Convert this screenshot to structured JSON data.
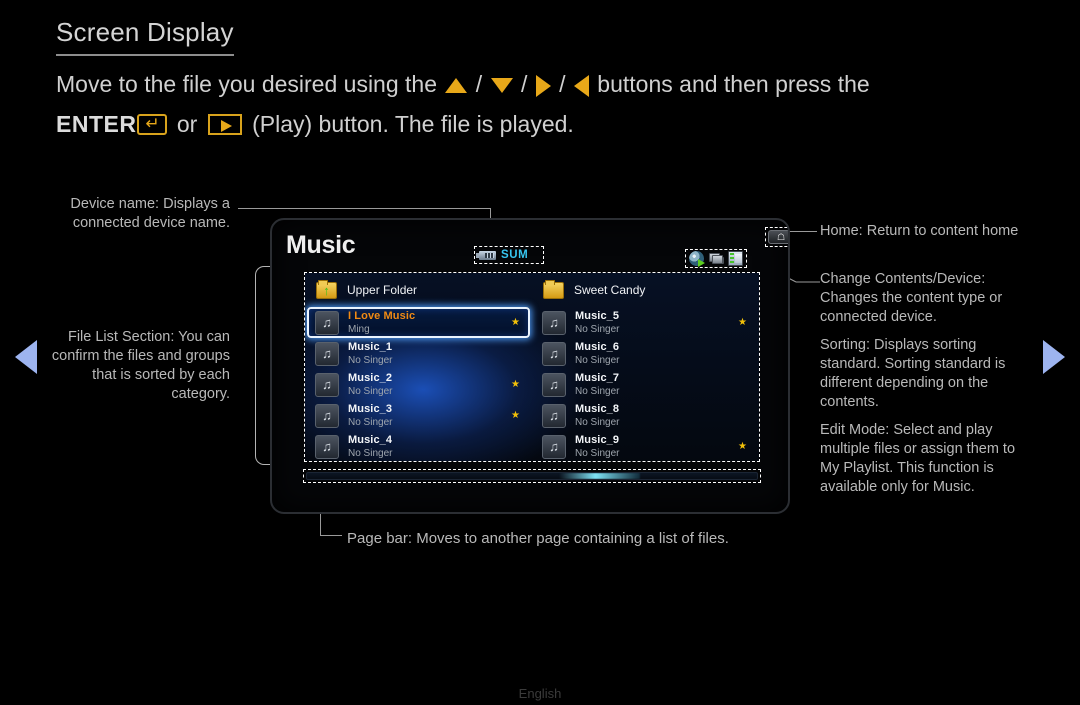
{
  "heading": "Screen Display",
  "intro": {
    "line1_a": "Move to the file you desired using the ",
    "sep1": " / ",
    "sep2": " / ",
    "sep3": " / ",
    "line1_b": " buttons and then press the",
    "enter_label": "ENTER",
    "or_label": " or ",
    "line2_b": " (Play) button. The file is played."
  },
  "nav": {
    "prev_icon": "triangle-left-icon",
    "next_icon": "triangle-right-icon"
  },
  "annotations": {
    "device_name": "Device name: Displays a connected device name.",
    "file_list": "File List Section: You can confirm the files and groups that is sorted by each category.",
    "page_bar": "Page bar: Moves to another page containing a list of files.",
    "home": "Home: Return to content home",
    "change_contents": "Change Contents/Device: Changes the content type or connected device.",
    "sorting": "Sorting: Displays sorting standard. Sorting standard is different depending on the contents.",
    "edit_mode": "Edit Mode: Select and play multiple files or assign them to My Playlist. This function is available only for Music."
  },
  "tv": {
    "title": "Music",
    "device_badge": {
      "label": "SUM",
      "icon": "usb-drive-icon",
      "color": "#37c6f0"
    },
    "home_button": {
      "icon": "home-icon"
    },
    "toolbar_icons": [
      {
        "name": "change-contents-device-icon",
        "label": "Change Contents/Device"
      },
      {
        "name": "sorting-icon",
        "label": "Sorting"
      },
      {
        "name": "edit-mode-icon",
        "label": "Edit Mode"
      }
    ],
    "list": {
      "left": [
        {
          "type": "folder",
          "icon": "folder-up-icon",
          "label": "Upper Folder"
        },
        {
          "type": "file",
          "icon": "music-note-icon",
          "title": "I Love Music",
          "subtitle": "Ming",
          "star": true,
          "selected": true
        },
        {
          "type": "file",
          "icon": "music-note-icon",
          "title": "Music_1",
          "subtitle": "No Singer",
          "star": false,
          "selected": false
        },
        {
          "type": "file",
          "icon": "music-note-icon",
          "title": "Music_2",
          "subtitle": "No Singer",
          "star": true,
          "selected": false
        },
        {
          "type": "file",
          "icon": "music-note-icon",
          "title": "Music_3",
          "subtitle": "No Singer",
          "star": true,
          "selected": false
        },
        {
          "type": "file",
          "icon": "music-note-icon",
          "title": "Music_4",
          "subtitle": "No Singer",
          "star": false,
          "selected": false
        }
      ],
      "right": [
        {
          "type": "folder",
          "icon": "folder-icon",
          "label": "Sweet Candy"
        },
        {
          "type": "file",
          "icon": "music-note-icon",
          "title": "Music_5",
          "subtitle": "No Singer",
          "star": true,
          "selected": false
        },
        {
          "type": "file",
          "icon": "music-note-icon",
          "title": "Music_6",
          "subtitle": "No Singer",
          "star": false,
          "selected": false
        },
        {
          "type": "file",
          "icon": "music-note-icon",
          "title": "Music_7",
          "subtitle": "No Singer",
          "star": false,
          "selected": false
        },
        {
          "type": "file",
          "icon": "music-note-icon",
          "title": "Music_8",
          "subtitle": "No Singer",
          "star": false,
          "selected": false
        },
        {
          "type": "file",
          "icon": "music-note-icon",
          "title": "Music_9",
          "subtitle": "No Singer",
          "star": true,
          "selected": false
        }
      ]
    },
    "page_bar": {
      "position_percent": 56,
      "width_percent": 18
    }
  },
  "footer": {
    "language": "English"
  },
  "colors": {
    "accent_orange": "#e8a819",
    "selected_title": "#f08a14",
    "badge_cyan": "#37c6f0",
    "star_yellow": "#f2c009",
    "nav_arrow": "#9db4f0",
    "list_glow_blue": "#1c52be"
  }
}
